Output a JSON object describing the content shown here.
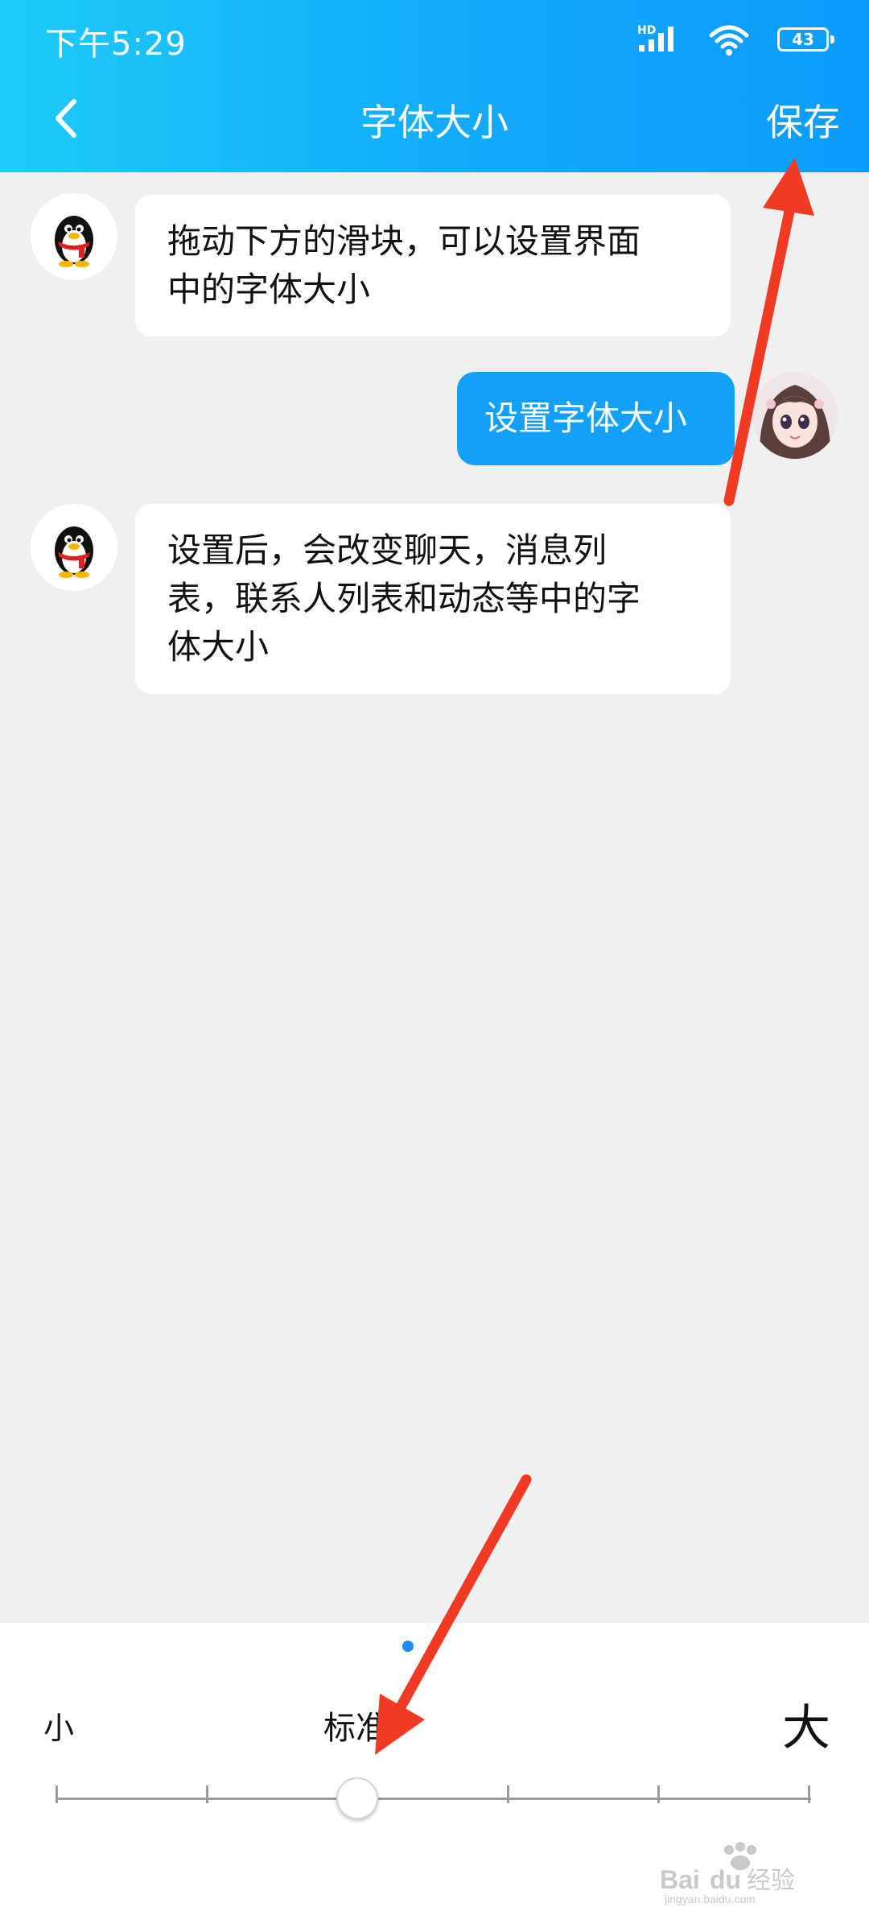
{
  "status_bar": {
    "time": "下午5:29",
    "network_tag": "HD",
    "battery": "43",
    "icons": [
      "signal-icon",
      "wifi-icon",
      "battery-icon"
    ]
  },
  "header": {
    "back_icon": "chevron-left-icon",
    "title": "字体大小",
    "save_label": "保存",
    "gradient_colors": [
      "#1ecbf7",
      "#0c9bfb"
    ]
  },
  "chat": {
    "messages": [
      {
        "sender": "bot",
        "avatar": "penguin-avatar",
        "text_lines": [
          "拖动下方的滑块，可以设置界面",
          "中的字体大小"
        ]
      },
      {
        "sender": "me",
        "avatar": "anime-girl-avatar",
        "text_lines": [
          "设置字体大小"
        ]
      },
      {
        "sender": "bot",
        "avatar": "penguin-avatar",
        "text_lines": [
          "设置后，会改变聊天，消息列",
          "表，联系人列表和动态等中的字",
          "体大小"
        ]
      }
    ],
    "bubble_colors": {
      "bot": "#ffffff",
      "me": "#12a0f8"
    }
  },
  "font_slider": {
    "label_small": "小",
    "label_standard": "标准",
    "label_large": "大",
    "steps": 6,
    "selected_index": 2,
    "accent_color": "#1d8cf0"
  },
  "annotations": {
    "arrow_color": "#f03a23",
    "watermark_text": "Baidu经验",
    "watermark_sub": "jingyan.baidu.com"
  }
}
